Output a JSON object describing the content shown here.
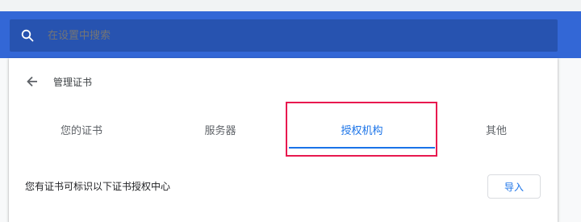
{
  "search": {
    "placeholder": "在设置中搜索",
    "icon": "search-icon"
  },
  "card": {
    "title": "管理证书",
    "back_icon": "arrow-back-icon"
  },
  "tabs": [
    {
      "label": "您的证书",
      "active": false
    },
    {
      "label": "服务器",
      "active": false
    },
    {
      "label": "授权机构",
      "active": true
    },
    {
      "label": "其他",
      "active": false
    }
  ],
  "content": {
    "description": "您有证书可标识以下证书授权中心",
    "import_label": "导入"
  },
  "colors": {
    "header": "#3367d6",
    "search_bg": "#2753b0",
    "accent": "#1a73e8",
    "highlight": "#e8194f"
  }
}
